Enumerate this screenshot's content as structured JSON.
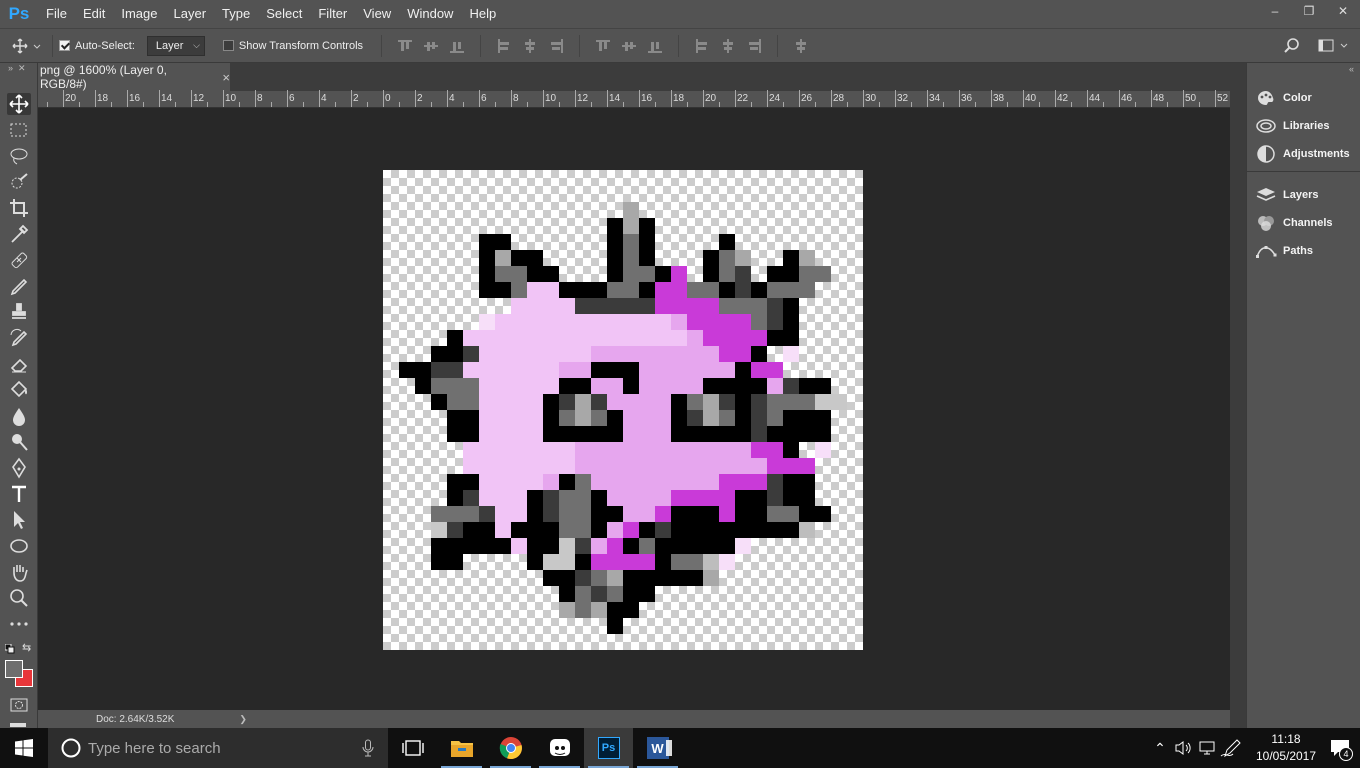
{
  "app": {
    "logo": "Ps"
  },
  "menu": [
    "File",
    "Edit",
    "Image",
    "Layer",
    "Type",
    "Select",
    "Filter",
    "View",
    "Window",
    "Help"
  ],
  "window_controls": {
    "minimize": "–",
    "restore": "❐",
    "close": "✕"
  },
  "options": {
    "auto_select_label": "Auto-Select:",
    "auto_select_checked": true,
    "auto_select_target": "Layer",
    "transform_label": "Show Transform Controls",
    "transform_checked": false
  },
  "document": {
    "tab_title": "png @ 1600% (Layer 0, RGB/8#)",
    "tab_close": "×",
    "zoom_percent": 1600
  },
  "ruler": {
    "labels": [
      "2",
      "20",
      "18",
      "16",
      "14",
      "12",
      "10",
      "8",
      "6",
      "4",
      "2",
      "0",
      "2",
      "4",
      "6",
      "8",
      "10",
      "12",
      "14",
      "16",
      "18",
      "20",
      "22",
      "24",
      "26",
      "28",
      "30",
      "32",
      "34",
      "36",
      "38",
      "40",
      "42",
      "44",
      "46",
      "48",
      "50",
      "52"
    ]
  },
  "status": {
    "doc": "Doc: 2.64K/3.52K",
    "arrow": "❯"
  },
  "panels": [
    {
      "label": "Color",
      "icon": "color-palette-icon"
    },
    {
      "label": "Libraries",
      "icon": "libraries-icon"
    },
    {
      "label": "Adjustments",
      "icon": "adjustments-icon"
    },
    {
      "label": "Layers",
      "icon": "layers-icon"
    },
    {
      "label": "Channels",
      "icon": "channels-icon"
    },
    {
      "label": "Paths",
      "icon": "paths-icon"
    }
  ],
  "colors": {
    "foreground": "#6e6e6e",
    "background": "#e8363a",
    "accent": "#31a8ff"
  },
  "sprite": {
    "palette": {
      "K": "#000000",
      "D": "#3b3b3b",
      "G": "#707070",
      "L": "#a8a8a8",
      "M": "#c8c8c8",
      "P": "#f1c4f6",
      "Q": "#e6a6ee",
      "V": "#c93ad8",
      "T": "#f7dff9",
      "W": "#bdbdbd"
    },
    "rows": [
      "..............................",
      "..............................",
      "...............L..............",
      "..............KLK.............",
      "......KK......KGK....K........",
      "......KLKK....KGK...KGL..KL...",
      "......KGGKK...KGGKV.KGD.KKGG..",
      "......KKGPPKKKGGKVVGGKDKGGG...",
      "........PPPPDDDDDVVVVGGGDK....",
      "......TPPPPPPPPPPPQVVVVGDK....",
      "....KPPPPPPPPPPPPPPQVVVVKK....",
      "...KKDPPPPPPPQQQQQQQQVVK.T....",
      ".KKDDPPPPPPQQKKKQQQQQQKVV.....",
      "..KGGGPPPPPKKQQKQQQQKKKKQDKK..",
      "...KGGPPPPKDLDQQQQKGLDKDGGGMM.",
      "....KKPPPPKGLGKQQQKDLGKDGKKK..",
      "....KKPPPPKKKKKQQQKKKKKDKKKK..",
      ".....PPPPPPPQQQQQQQQQQQVVK.T...",
      ".....PPPPPPPQQQQQQQQQQQQVVV....",
      "....KKPPPPQKGQQQQQQQQVVVDKK....",
      "....KDPPPKDGGKQQQQVVVVKKDKK....",
      "...GGGDPPKDGGKKQQVKKKVKKGGKK...",
      "...MDKKPKKKGGKQVKDKKKKKKKKW....",
      "...KKKKKPKKMDQVKGKKKKKT........",
      "...KK....KMMKVVVVKGGWT.........",
      "..........KKDGLKKKKKL..........",
      "...........KGDGKK..............",
      "...........LGLKK...............",
      "..............K................",
      ".............................."
    ]
  }
}
